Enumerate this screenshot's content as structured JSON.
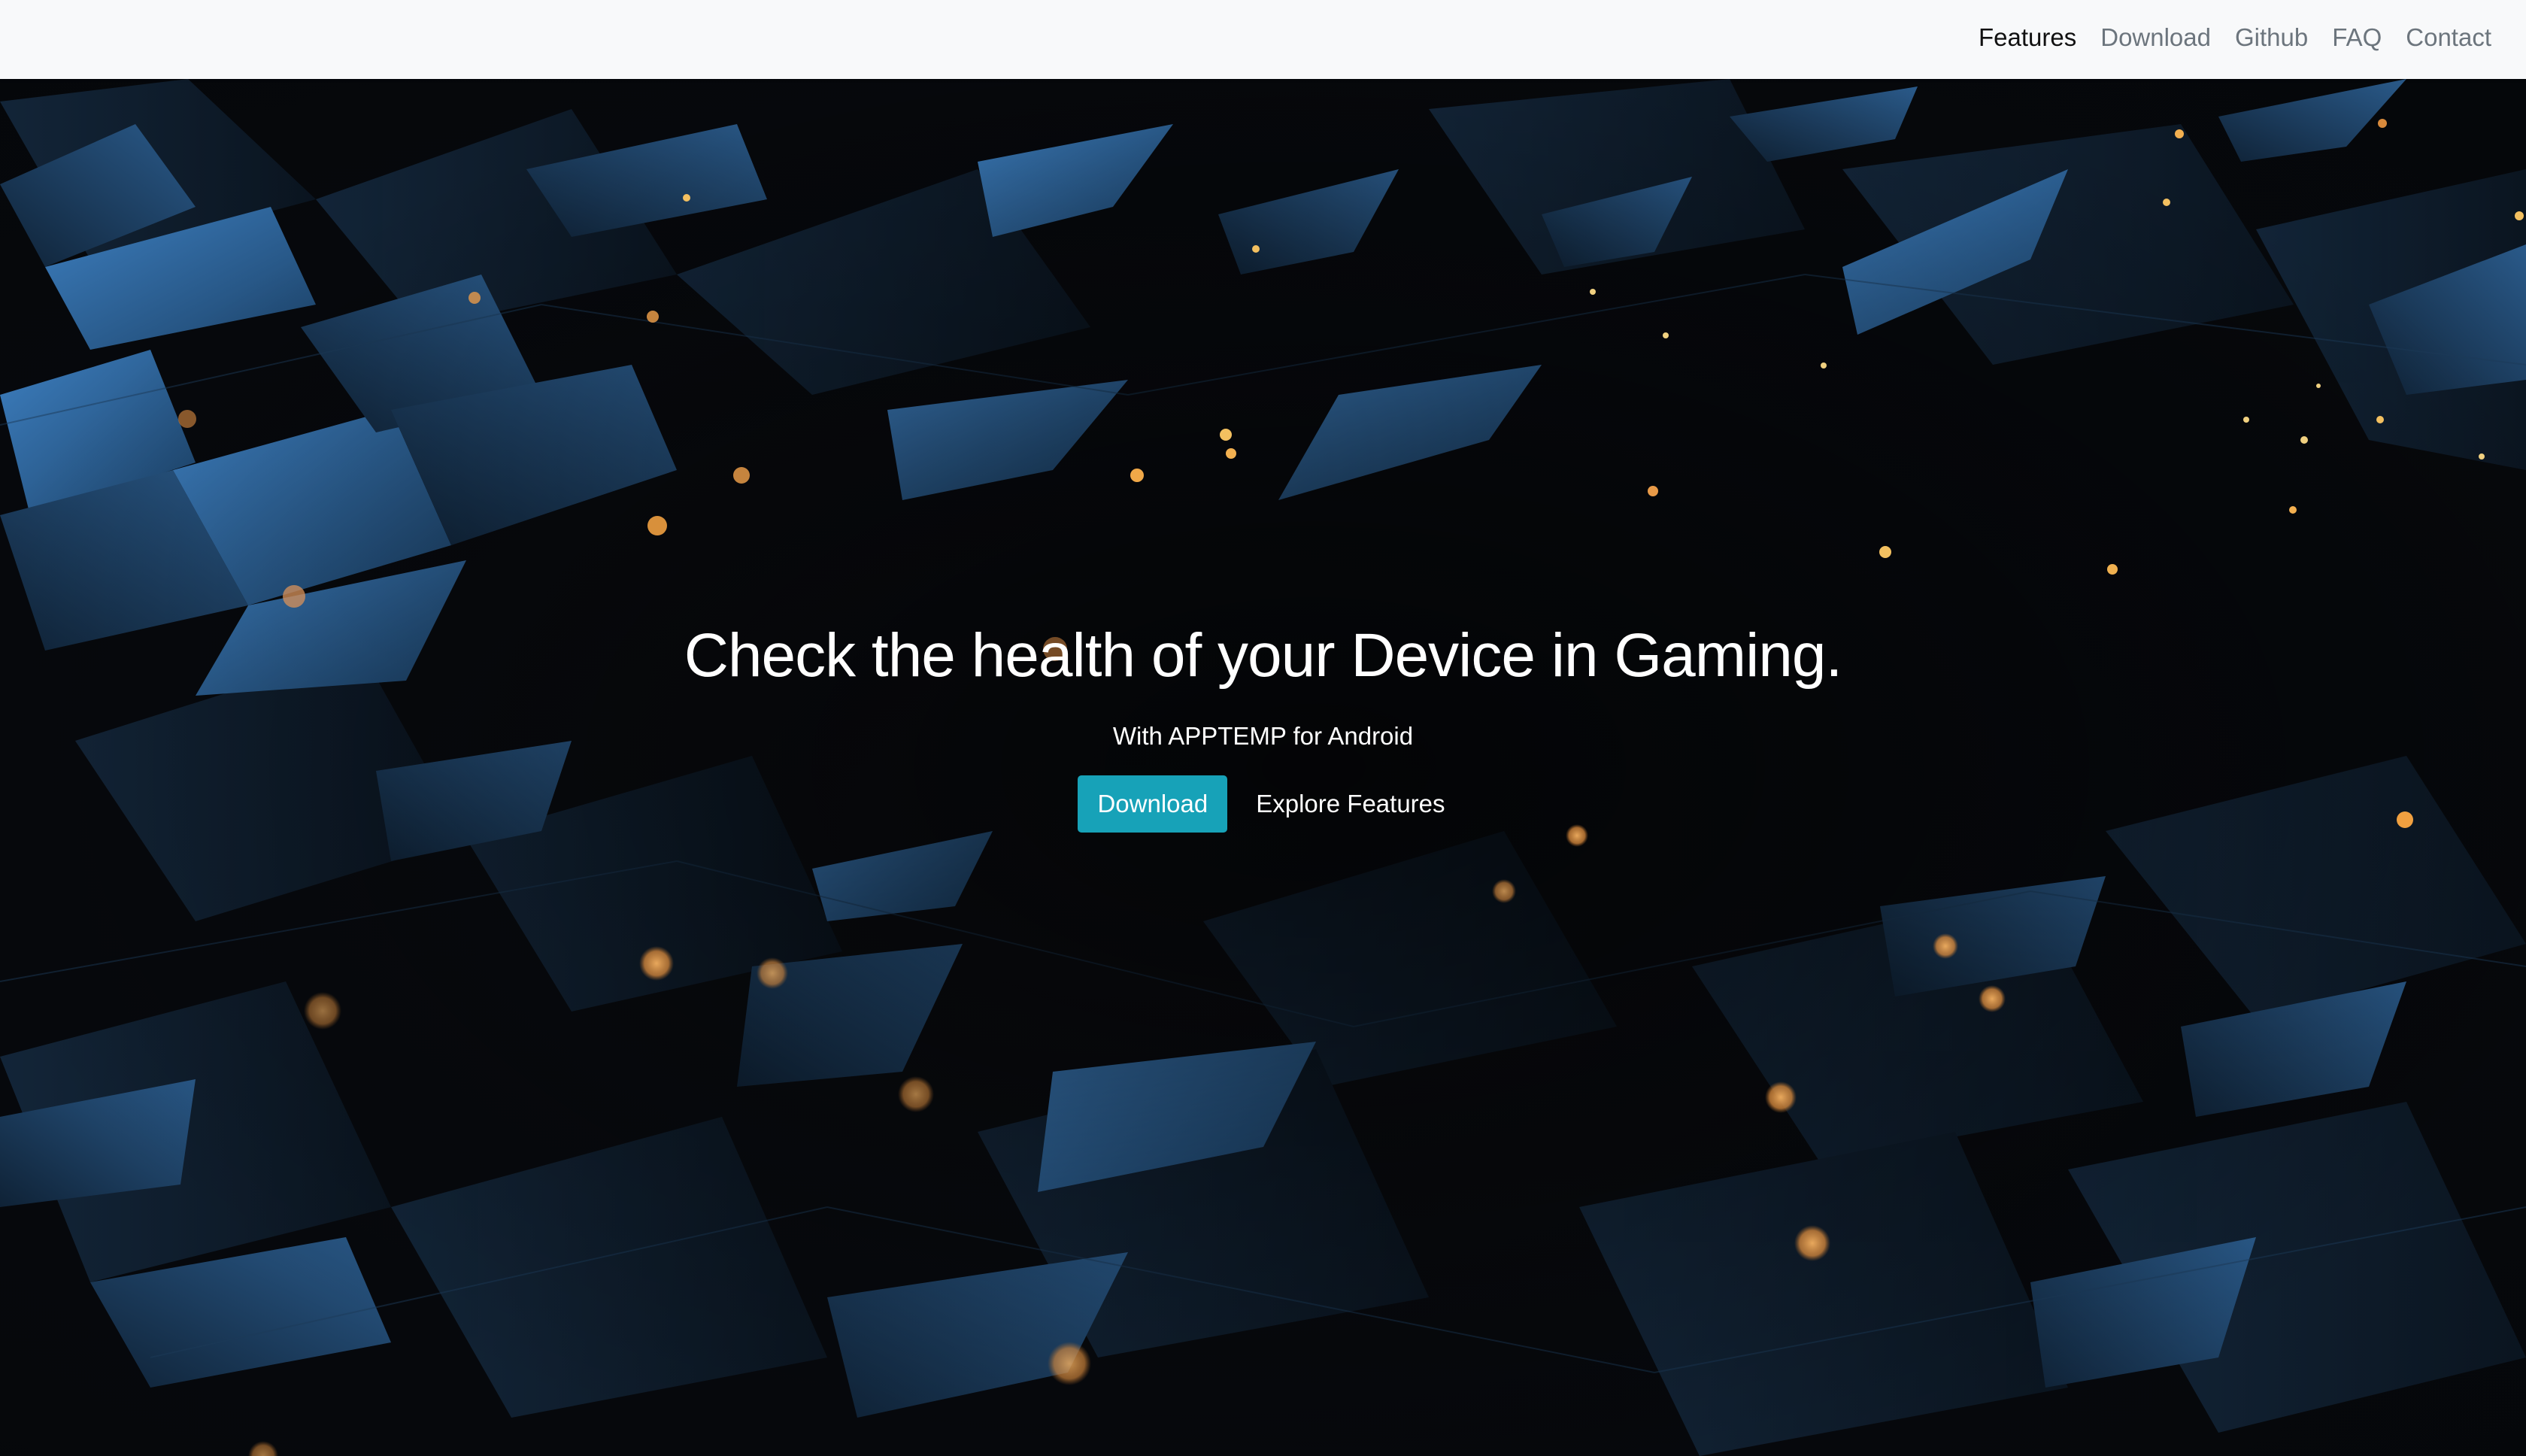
{
  "nav": {
    "items": [
      {
        "label": "Features",
        "active": true
      },
      {
        "label": "Download",
        "active": false
      },
      {
        "label": "Github",
        "active": false
      },
      {
        "label": "FAQ",
        "active": false
      },
      {
        "label": "Contact",
        "active": false
      }
    ]
  },
  "hero": {
    "title": "Check the health of your Device in Gaming.",
    "subtitle": "With APPTEMP for Android",
    "download_label": "Download",
    "explore_label": "Explore Features"
  },
  "colors": {
    "navbar_bg": "#f8f9fa",
    "accent": "#17a2b8",
    "hero_text": "#ffffff",
    "background_facets": "#2f6aa3",
    "particles": "#f0a050"
  }
}
